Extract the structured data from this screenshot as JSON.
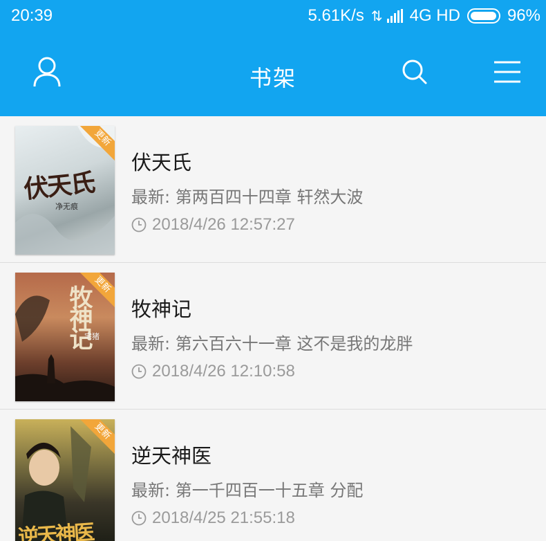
{
  "status_bar": {
    "time": "20:39",
    "speed": "5.61K/s",
    "network": "4G HD",
    "battery": "96%"
  },
  "header": {
    "title": "书架",
    "icons": [
      "user-icon",
      "search-icon",
      "menu-icon"
    ]
  },
  "books": [
    {
      "title": "伏天氏",
      "latest_prefix": "最新: ",
      "latest_chapter": "第两百四十四章 轩然大波",
      "updated": "2018/4/26 12:57:27",
      "badge": "更新",
      "cover_text": "伏天氏",
      "cover_author": "净无痕"
    },
    {
      "title": "牧神记",
      "latest_prefix": "最新: ",
      "latest_chapter": "第六百六十一章 这不是我的龙胖",
      "updated": "2018/4/26 12:10:58",
      "badge": "更新",
      "cover_text": "牧神记",
      "cover_author": "宅猪"
    },
    {
      "title": "逆天神医",
      "latest_prefix": "最新: ",
      "latest_chapter": "第一千四百一十五章 分配",
      "updated": "2018/4/25 21:55:18",
      "badge": "更新",
      "cover_text": "逆天神医",
      "cover_author": ""
    }
  ],
  "colors": {
    "primary": "#12a5f0",
    "badge": "#f2a63a"
  }
}
